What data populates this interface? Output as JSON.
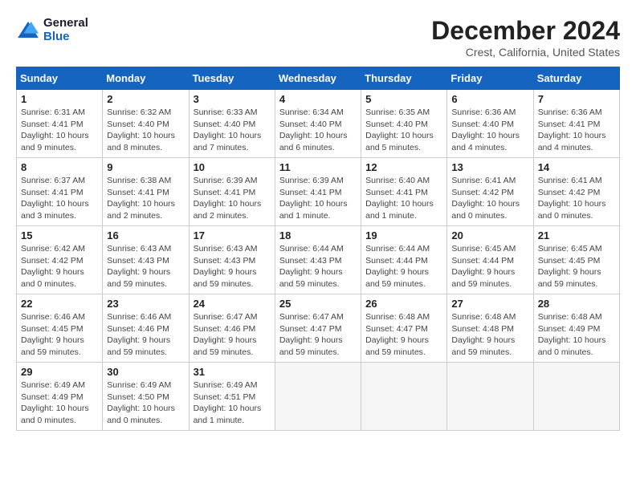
{
  "header": {
    "logo_line1": "General",
    "logo_line2": "Blue",
    "month": "December 2024",
    "location": "Crest, California, United States"
  },
  "weekdays": [
    "Sunday",
    "Monday",
    "Tuesday",
    "Wednesday",
    "Thursday",
    "Friday",
    "Saturday"
  ],
  "weeks": [
    [
      {
        "day": "1",
        "sunrise": "6:31 AM",
        "sunset": "4:41 PM",
        "daylight": "10 hours and 9 minutes."
      },
      {
        "day": "2",
        "sunrise": "6:32 AM",
        "sunset": "4:40 PM",
        "daylight": "10 hours and 8 minutes."
      },
      {
        "day": "3",
        "sunrise": "6:33 AM",
        "sunset": "4:40 PM",
        "daylight": "10 hours and 7 minutes."
      },
      {
        "day": "4",
        "sunrise": "6:34 AM",
        "sunset": "4:40 PM",
        "daylight": "10 hours and 6 minutes."
      },
      {
        "day": "5",
        "sunrise": "6:35 AM",
        "sunset": "4:40 PM",
        "daylight": "10 hours and 5 minutes."
      },
      {
        "day": "6",
        "sunrise": "6:36 AM",
        "sunset": "4:40 PM",
        "daylight": "10 hours and 4 minutes."
      },
      {
        "day": "7",
        "sunrise": "6:36 AM",
        "sunset": "4:41 PM",
        "daylight": "10 hours and 4 minutes."
      }
    ],
    [
      {
        "day": "8",
        "sunrise": "6:37 AM",
        "sunset": "4:41 PM",
        "daylight": "10 hours and 3 minutes."
      },
      {
        "day": "9",
        "sunrise": "6:38 AM",
        "sunset": "4:41 PM",
        "daylight": "10 hours and 2 minutes."
      },
      {
        "day": "10",
        "sunrise": "6:39 AM",
        "sunset": "4:41 PM",
        "daylight": "10 hours and 2 minutes."
      },
      {
        "day": "11",
        "sunrise": "6:39 AM",
        "sunset": "4:41 PM",
        "daylight": "10 hours and 1 minute."
      },
      {
        "day": "12",
        "sunrise": "6:40 AM",
        "sunset": "4:41 PM",
        "daylight": "10 hours and 1 minute."
      },
      {
        "day": "13",
        "sunrise": "6:41 AM",
        "sunset": "4:42 PM",
        "daylight": "10 hours and 0 minutes."
      },
      {
        "day": "14",
        "sunrise": "6:41 AM",
        "sunset": "4:42 PM",
        "daylight": "10 hours and 0 minutes."
      }
    ],
    [
      {
        "day": "15",
        "sunrise": "6:42 AM",
        "sunset": "4:42 PM",
        "daylight": "9 hours and 0 minutes."
      },
      {
        "day": "16",
        "sunrise": "6:43 AM",
        "sunset": "4:43 PM",
        "daylight": "9 hours and 59 minutes."
      },
      {
        "day": "17",
        "sunrise": "6:43 AM",
        "sunset": "4:43 PM",
        "daylight": "9 hours and 59 minutes."
      },
      {
        "day": "18",
        "sunrise": "6:44 AM",
        "sunset": "4:43 PM",
        "daylight": "9 hours and 59 minutes."
      },
      {
        "day": "19",
        "sunrise": "6:44 AM",
        "sunset": "4:44 PM",
        "daylight": "9 hours and 59 minutes."
      },
      {
        "day": "20",
        "sunrise": "6:45 AM",
        "sunset": "4:44 PM",
        "daylight": "9 hours and 59 minutes."
      },
      {
        "day": "21",
        "sunrise": "6:45 AM",
        "sunset": "4:45 PM",
        "daylight": "9 hours and 59 minutes."
      }
    ],
    [
      {
        "day": "22",
        "sunrise": "6:46 AM",
        "sunset": "4:45 PM",
        "daylight": "9 hours and 59 minutes."
      },
      {
        "day": "23",
        "sunrise": "6:46 AM",
        "sunset": "4:46 PM",
        "daylight": "9 hours and 59 minutes."
      },
      {
        "day": "24",
        "sunrise": "6:47 AM",
        "sunset": "4:46 PM",
        "daylight": "9 hours and 59 minutes."
      },
      {
        "day": "25",
        "sunrise": "6:47 AM",
        "sunset": "4:47 PM",
        "daylight": "9 hours and 59 minutes."
      },
      {
        "day": "26",
        "sunrise": "6:48 AM",
        "sunset": "4:47 PM",
        "daylight": "9 hours and 59 minutes."
      },
      {
        "day": "27",
        "sunrise": "6:48 AM",
        "sunset": "4:48 PM",
        "daylight": "9 hours and 59 minutes."
      },
      {
        "day": "28",
        "sunrise": "6:48 AM",
        "sunset": "4:49 PM",
        "daylight": "10 hours and 0 minutes."
      }
    ],
    [
      {
        "day": "29",
        "sunrise": "6:49 AM",
        "sunset": "4:49 PM",
        "daylight": "10 hours and 0 minutes."
      },
      {
        "day": "30",
        "sunrise": "6:49 AM",
        "sunset": "4:50 PM",
        "daylight": "10 hours and 0 minutes."
      },
      {
        "day": "31",
        "sunrise": "6:49 AM",
        "sunset": "4:51 PM",
        "daylight": "10 hours and 1 minute."
      },
      null,
      null,
      null,
      null
    ]
  ],
  "labels": {
    "sunrise": "Sunrise:",
    "sunset": "Sunset:",
    "daylight": "Daylight:"
  }
}
